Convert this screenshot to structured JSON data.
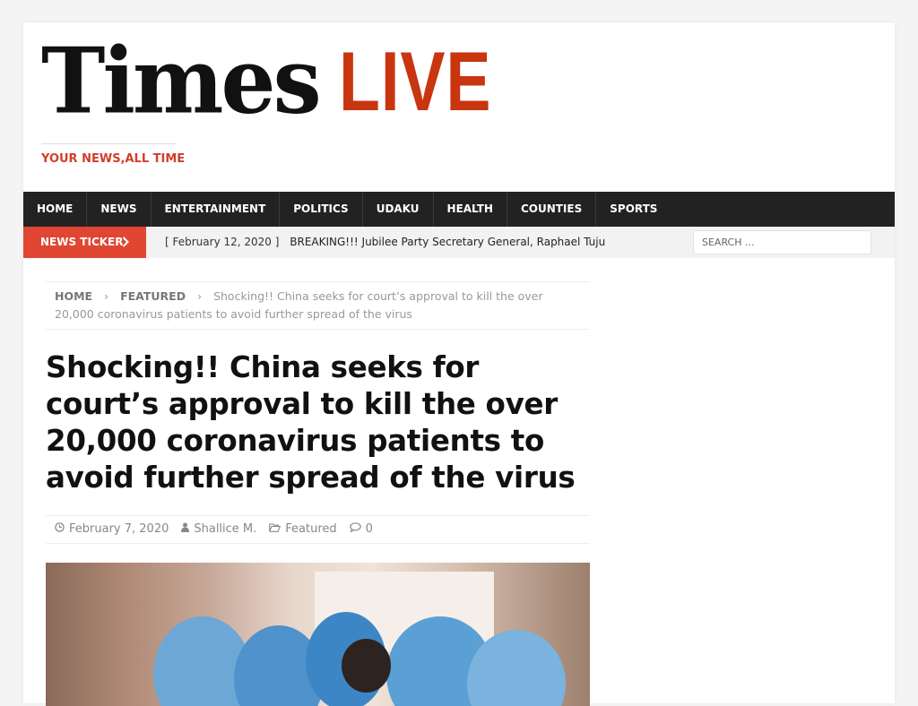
{
  "logo": {
    "times": "Times",
    "live": "LIVE"
  },
  "tagline": "YOUR NEWS,ALL TIME",
  "nav": {
    "items": [
      "HOME",
      "NEWS",
      "ENTERTAINMENT",
      "POLITICS",
      "UDAKU",
      "HEALTH",
      "COUNTIES",
      "SPORTS"
    ]
  },
  "ticker": {
    "label": "NEWS TICKER",
    "date": "[ February 12, 2020 ]",
    "headline": "BREAKING!!! Jubilee Party Secretary General, Raphael Tuju"
  },
  "search": {
    "placeholder": "SEARCH ..."
  },
  "breadcrumb": {
    "home": "HOME",
    "category": "FEATURED",
    "current": "Shocking!! China seeks for court’s approval to kill the over 20,000 coronavirus patients to avoid further spread of the virus"
  },
  "article": {
    "title": "Shocking!! China seeks for court’s approval to kill the over 20,000 coronavirus patients to avoid further spread of the virus",
    "date": "February 7, 2020",
    "author": "Shallice M.",
    "category": "Featured",
    "comments": "0"
  },
  "colors": {
    "accent": "#e04632",
    "brand_live": "#c8350f",
    "nav_bg": "#222222"
  },
  "icons": {
    "ticker_arrow": "chevron-right-icon",
    "date": "clock-icon",
    "author": "user-icon",
    "category": "folder-icon",
    "comments": "comment-icon"
  }
}
